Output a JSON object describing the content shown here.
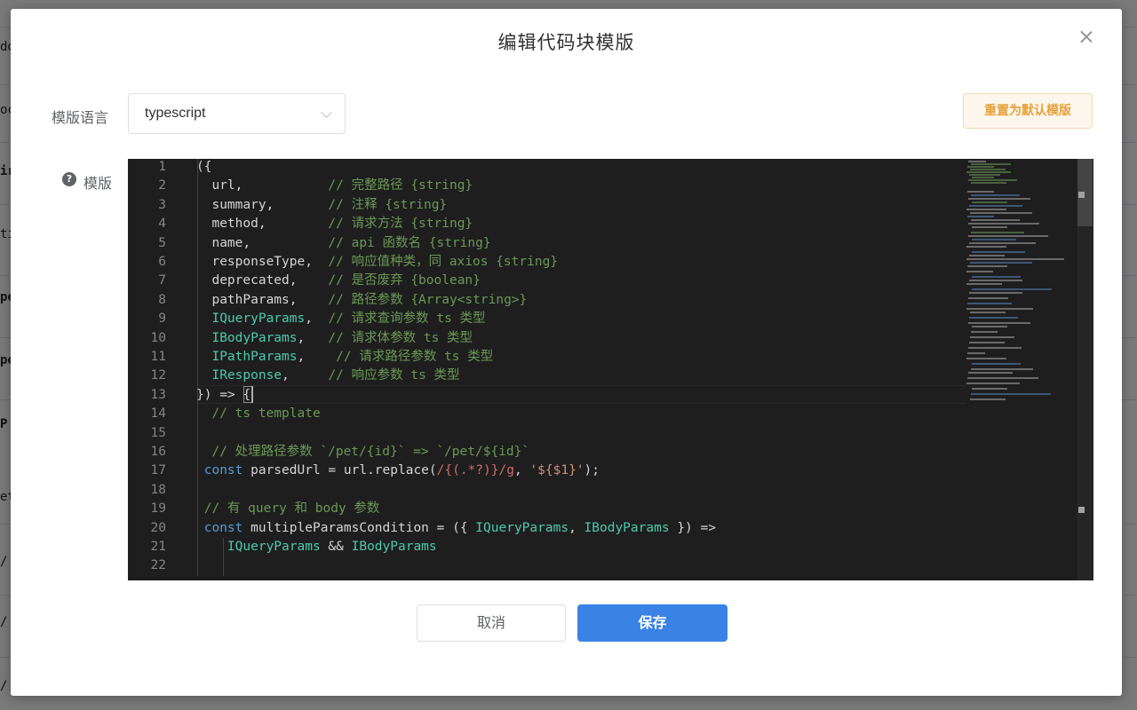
{
  "dialog": {
    "title": "编辑代码块模版",
    "language_label": "模版语言",
    "template_label": "模版",
    "language_value": "typescript",
    "reset_label": "重置为默认模版",
    "cancel_label": "取消",
    "save_label": "保存"
  },
  "editor": {
    "line_numbers": [
      "1",
      "2",
      "3",
      "4",
      "5",
      "6",
      "7",
      "8",
      "9",
      "10",
      "11",
      "12",
      "13",
      "14",
      "15",
      "16",
      "17",
      "18",
      "19",
      "20",
      "21",
      "22"
    ],
    "lines": [
      [
        {
          "t": "({",
          "c": ""
        }
      ],
      [
        {
          "t": "  url,           ",
          "c": ""
        },
        {
          "t": "// 完整路径 {string}",
          "c": "com"
        }
      ],
      [
        {
          "t": "  summary,       ",
          "c": ""
        },
        {
          "t": "// 注释 {string}",
          "c": "com"
        }
      ],
      [
        {
          "t": "  method,        ",
          "c": ""
        },
        {
          "t": "// 请求方法 {string}",
          "c": "com"
        }
      ],
      [
        {
          "t": "  name,          ",
          "c": ""
        },
        {
          "t": "// api 函数名 {string}",
          "c": "com"
        }
      ],
      [
        {
          "t": "  responseType,  ",
          "c": ""
        },
        {
          "t": "// 响应值种类，同 axios {string}",
          "c": "com"
        }
      ],
      [
        {
          "t": "  deprecated,    ",
          "c": ""
        },
        {
          "t": "// 是否废弃 {boolean}",
          "c": "com"
        }
      ],
      [
        {
          "t": "  pathParams,    ",
          "c": ""
        },
        {
          "t": "// 路径参数 {Array<string>}",
          "c": "com"
        }
      ],
      [
        {
          "t": "  ",
          "c": ""
        },
        {
          "t": "IQueryParams",
          "c": "ty"
        },
        {
          "t": ",  ",
          "c": ""
        },
        {
          "t": "// 请求查询参数 ts 类型",
          "c": "com"
        }
      ],
      [
        {
          "t": "  ",
          "c": ""
        },
        {
          "t": "IBodyParams",
          "c": "ty"
        },
        {
          "t": ",   ",
          "c": ""
        },
        {
          "t": "// 请求体参数 ts 类型",
          "c": "com"
        }
      ],
      [
        {
          "t": "  ",
          "c": ""
        },
        {
          "t": "IPathParams",
          "c": "ty"
        },
        {
          "t": ",    ",
          "c": ""
        },
        {
          "t": "// 请求路径参数 ts 类型",
          "c": "com"
        }
      ],
      [
        {
          "t": "  ",
          "c": ""
        },
        {
          "t": "IResponse",
          "c": "ty"
        },
        {
          "t": ",     ",
          "c": ""
        },
        {
          "t": "// 响应参数 ts 类型",
          "c": "com"
        }
      ],
      [
        {
          "t": "}) => {",
          "c": ""
        }
      ],
      [
        {
          "t": "  ",
          "c": ""
        },
        {
          "t": "// ts template",
          "c": "com"
        }
      ],
      [
        {
          "t": "",
          "c": ""
        }
      ],
      [
        {
          "t": "  ",
          "c": ""
        },
        {
          "t": "// 处理路径参数 `/pet/{id}` => `/pet/${id}`",
          "c": "com"
        }
      ],
      [
        {
          "t": " ",
          "c": ""
        },
        {
          "t": "const",
          "c": "kw"
        },
        {
          "t": " parsedUrl = url.replace(",
          "c": ""
        },
        {
          "t": "/{(.*?)}/g",
          "c": "re"
        },
        {
          "t": ", ",
          "c": ""
        },
        {
          "t": "'${$1}'",
          "c": "str"
        },
        {
          "t": ");",
          "c": ""
        }
      ],
      [
        {
          "t": "",
          "c": ""
        }
      ],
      [
        {
          "t": " ",
          "c": ""
        },
        {
          "t": "// 有 query 和 body 参数",
          "c": "com"
        }
      ],
      [
        {
          "t": " ",
          "c": ""
        },
        {
          "t": "const",
          "c": "kw"
        },
        {
          "t": " multipleParamsCondition = ({ ",
          "c": ""
        },
        {
          "t": "IQueryParams",
          "c": "ty"
        },
        {
          "t": ", ",
          "c": ""
        },
        {
          "t": "IBodyParams",
          "c": "ty"
        },
        {
          "t": " }) =>",
          "c": ""
        }
      ],
      [
        {
          "t": "    ",
          "c": ""
        },
        {
          "t": "IQueryParams",
          "c": "ty"
        },
        {
          "t": " && ",
          "c": ""
        },
        {
          "t": "IBodyParams",
          "c": "ty"
        }
      ],
      [
        {
          "t": "",
          "c": ""
        }
      ]
    ]
  },
  "background": {
    "fragments": [
      "do",
      "oc",
      "ir",
      "ti",
      "pe",
      "pe",
      "P",
      "et",
      "/",
      "/",
      "/"
    ]
  },
  "colors": {
    "primary": "#3b82e6",
    "warning_text": "#e6a23c",
    "editor_bg": "#1e1e1e",
    "comment": "#6a9955",
    "keyword": "#569cd6",
    "type": "#4ec9b0"
  }
}
